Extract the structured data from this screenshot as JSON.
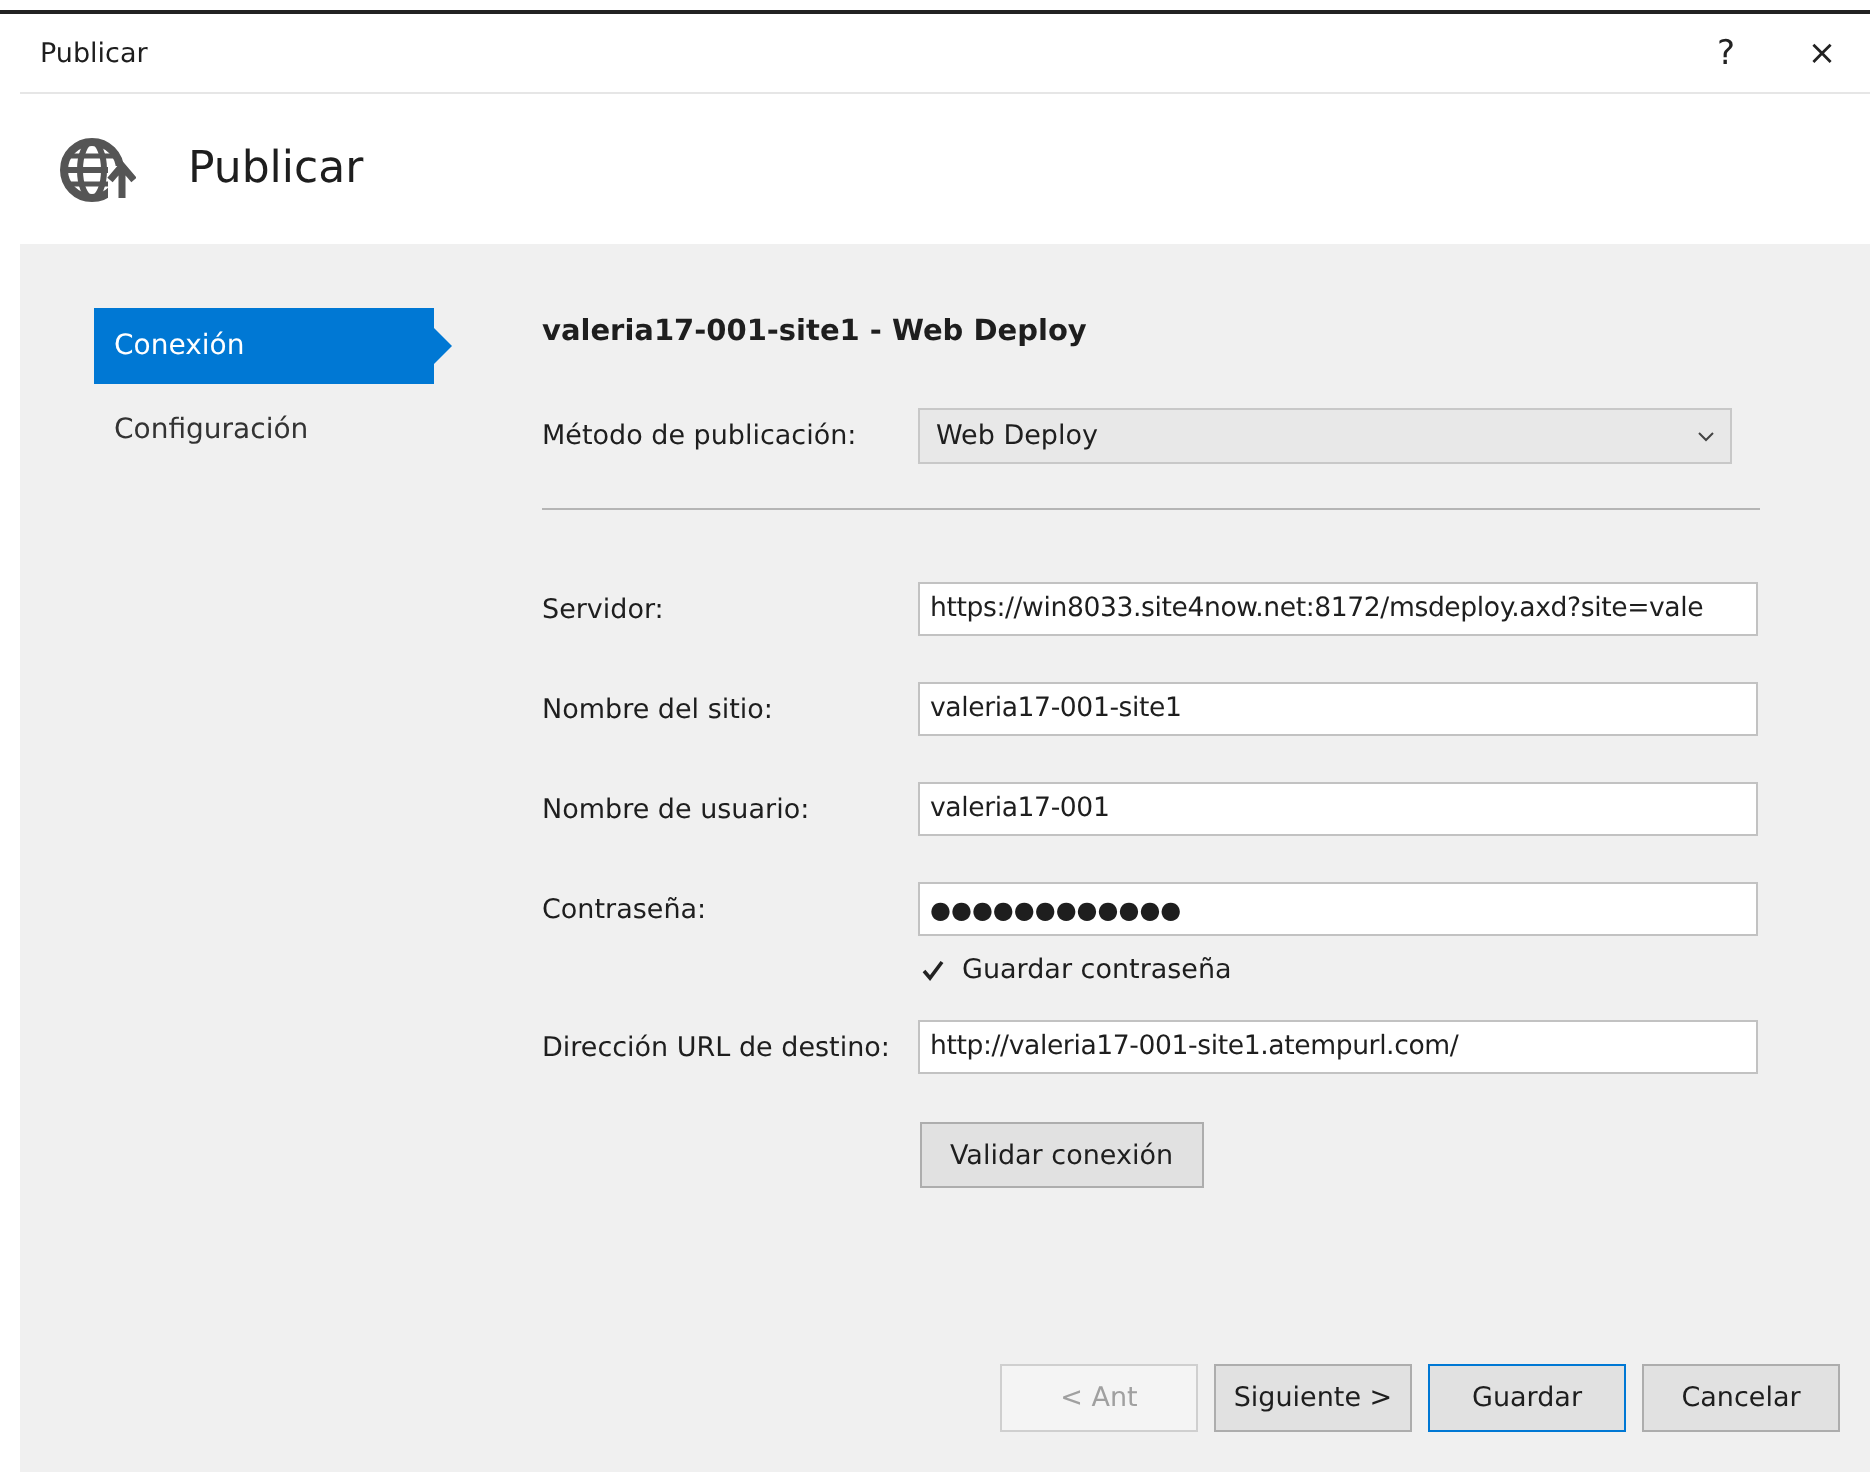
{
  "window": {
    "title": "Publicar",
    "help": "?",
    "close": "×"
  },
  "header": {
    "title": "Publicar"
  },
  "sidebar": {
    "items": [
      {
        "label": "Conexión",
        "selected": true
      },
      {
        "label": "Configuración",
        "selected": false
      }
    ]
  },
  "content": {
    "title": "valeria17-001-site1 - Web Deploy",
    "rows": [
      {
        "kind": "dropdown",
        "label": "Método de publicación:",
        "value": "Web Deploy"
      },
      {
        "kind": "separator"
      },
      {
        "kind": "text",
        "label": "Servidor:",
        "value": "https://win8033.site4now.net:8172/msdeploy.axd?site=vale"
      },
      {
        "kind": "text",
        "label": "Nombre del sitio:",
        "value": "valeria17-001-site1"
      },
      {
        "kind": "text",
        "label": "Nombre de usuario:",
        "value": "valeria17-001"
      },
      {
        "kind": "password",
        "label": "Contraseña:",
        "value": "●●●●●●●●●●●●"
      },
      {
        "kind": "checkbox",
        "label": "Guardar contraseña",
        "checked": true
      },
      {
        "kind": "text",
        "label": "Dirección URL de destino:",
        "value": "http://valeria17-001-site1.atempurl.com/"
      },
      {
        "kind": "button",
        "label": "Validar conexión"
      }
    ]
  },
  "buttons": [
    {
      "label": "< Ant",
      "disabled": true,
      "default": false
    },
    {
      "label": "Siguiente >",
      "disabled": false,
      "default": false
    },
    {
      "label": "Guardar",
      "disabled": false,
      "default": true
    },
    {
      "label": "Cancelar",
      "disabled": false,
      "default": false
    }
  ]
}
